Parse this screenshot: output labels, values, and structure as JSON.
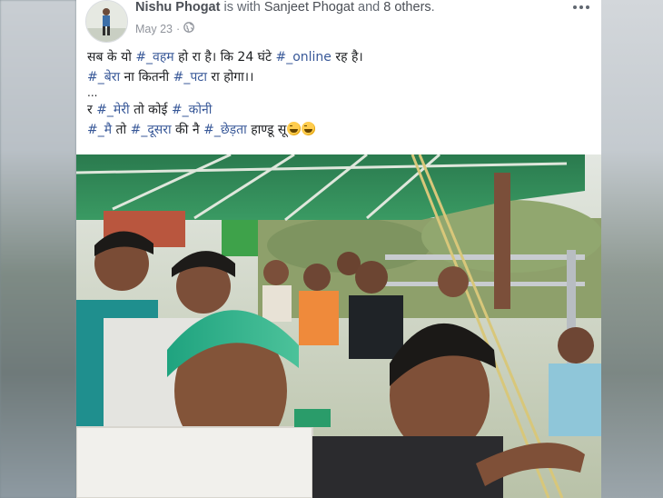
{
  "post": {
    "author": "Nishu Phogat",
    "with_text": "is with",
    "tagged_name": "Sanjeet Phogat",
    "and_text": "and",
    "others": "8 others",
    "period": ".",
    "date": "May 23",
    "separator": "·",
    "privacy_icon": "globe-icon",
    "more_icon": "more-options-icon",
    "text": {
      "line1_a": "सब के यो ",
      "line1_tag1": "#_वहम",
      "line1_b": " हो रा है। कि 24 घंटे ",
      "line1_tag2": "#_online",
      "line1_c": " रह है।",
      "line2_tag1": "#_बेरा",
      "line2_a": " ना कितनी ",
      "line2_tag2": "#_पटा",
      "line2_b": " रा होगा।।",
      "line3": "...",
      "line4_a": "र ",
      "line4_tag1": "#_मेरी",
      "line4_b": " तो कोई ",
      "line4_tag2": "#_कोनी",
      "line5_tag1": "#_मै",
      "line5_a": " तो ",
      "line5_tag2": "#_दूसरा",
      "line5_b": " की नै ",
      "line5_tag3": "#_छेड़ता",
      "line5_c": " हाण्डू सू",
      "emoji_icon": "tears-of-joy-emoji"
    },
    "photo_description": "group-selfie-photo"
  },
  "colors": {
    "name": "#4b4f56",
    "hashtag": "#385898",
    "meta": "#90949c",
    "canopy": "#2f8b5a"
  }
}
